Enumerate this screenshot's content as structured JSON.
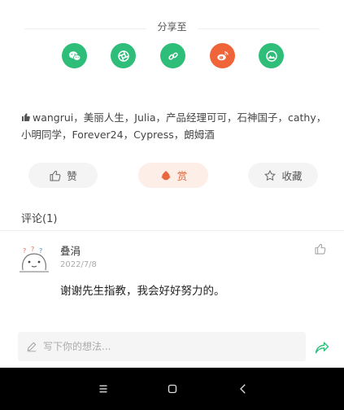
{
  "share": {
    "title": "分享至",
    "icons": [
      {
        "name": "wechat-icon",
        "color": "#2fbe7a"
      },
      {
        "name": "moments-icon",
        "color": "#2fbe7a"
      },
      {
        "name": "link-icon",
        "color": "#2fbe7a"
      },
      {
        "name": "weibo-icon",
        "color": "#f0643a"
      },
      {
        "name": "image-icon",
        "color": "#2fbe7a"
      }
    ]
  },
  "likes": {
    "text": "wangrui，美丽人生，Julia，产品经理可可，石神国子，cathy，小明同学，Forever24，Cypress，朗姆酒"
  },
  "actions": {
    "like_label": "赞",
    "reward_label": "赏",
    "favorite_label": "收藏"
  },
  "comments": {
    "section_title": "评论(1)",
    "items": [
      {
        "author": "叠涓",
        "date": "2022/7/8",
        "text": "谢谢先生指教，我会好好努力的。"
      }
    ]
  },
  "input": {
    "placeholder": "写下你的想法..."
  },
  "colors": {
    "accent_green": "#2fbe7a",
    "accent_orange": "#e8673c"
  }
}
